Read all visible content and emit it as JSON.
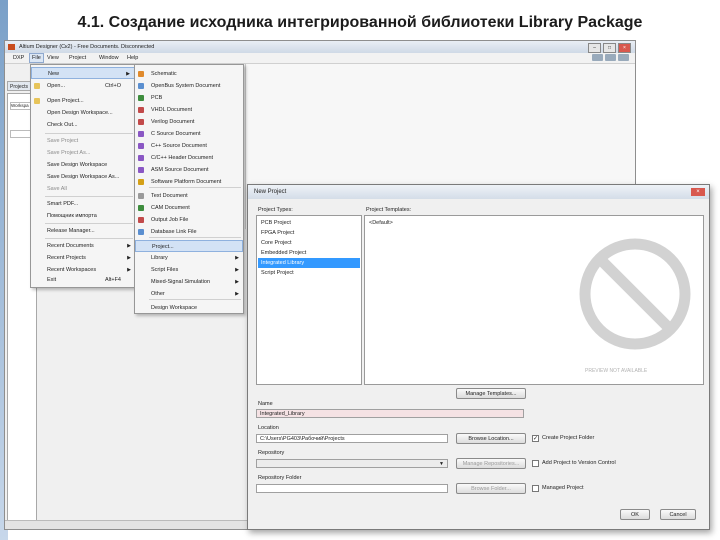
{
  "slide": {
    "title": "4.1. Создание исходника интегрированной библиотеки Library Package"
  },
  "app": {
    "title": "Altium Designer (Ск2) - Free Documents. Disconnected",
    "menu": [
      "DXP",
      "File",
      "View",
      "Project",
      "Window",
      "Help"
    ],
    "panel_tab": "Projects",
    "panel_field_1": "Workspa",
    "panel_field_2": ""
  },
  "file_menu": {
    "items": [
      {
        "label": "New",
        "shortcut": "",
        "submenu": true,
        "highlight": true
      },
      {
        "label": "Open...",
        "shortcut": "Ctrl+O"
      },
      {
        "label": "Open Project..."
      },
      {
        "label": "Open Design Workspace..."
      },
      {
        "label": "Check Out..."
      },
      {
        "label": "Save Project",
        "dim": true
      },
      {
        "label": "Save Project As...",
        "dim": true
      },
      {
        "label": "Save Design Workspace"
      },
      {
        "label": "Save Design Workspace As..."
      },
      {
        "label": "Save All",
        "dim": true
      },
      {
        "label": "Smart PDF..."
      },
      {
        "label": "Помощник импорта"
      },
      {
        "label": "Release Manager..."
      },
      {
        "label": "Recent Documents",
        "submenu": true
      },
      {
        "label": "Recent Projects",
        "submenu": true
      },
      {
        "label": "Recent Workspaces",
        "submenu": true
      },
      {
        "label": "Exit",
        "shortcut": "Alt+F4"
      }
    ]
  },
  "new_submenu": {
    "items": [
      {
        "label": "Schematic",
        "color": "#e08a2c"
      },
      {
        "label": "OpenBus System Document",
        "color": "#5b8fd0"
      },
      {
        "label": "PCB",
        "color": "#3d8d3d"
      },
      {
        "label": "VHDL Document",
        "color": "#c24a4a"
      },
      {
        "label": "Verilog Document",
        "color": "#c24a4a"
      },
      {
        "label": "C Source Document",
        "color": "#8a57c4"
      },
      {
        "label": "C++ Source Document",
        "color": "#8a57c4"
      },
      {
        "label": "C/C++ Header Document",
        "color": "#8a57c4"
      },
      {
        "label": "ASM Source Document",
        "color": "#8a57c4"
      },
      {
        "label": "Software Platform Document",
        "color": "#d4a017"
      },
      {
        "label": "Text Document",
        "color": "#9a9a9a"
      },
      {
        "label": "CAM Document",
        "color": "#3d8d3d"
      },
      {
        "label": "Output Job File",
        "color": "#c24a4a"
      },
      {
        "label": "Database Link File",
        "color": "#5b8fd0"
      },
      {
        "label": "Project...",
        "highlight": true
      },
      {
        "label": "Library",
        "submenu": true
      },
      {
        "label": "Script Files",
        "submenu": true
      },
      {
        "label": "Mixed-Signal Simulation",
        "submenu": true
      },
      {
        "label": "Other",
        "submenu": true
      },
      {
        "label": "Design Workspace"
      }
    ]
  },
  "dialog": {
    "title": "New Project",
    "project_types_label": "Project Types:",
    "project_types": [
      "PCB Project",
      "FPGA Project",
      "Core Project",
      "Embedded Project",
      "Integrated Library",
      "Script Project"
    ],
    "selected_index": 4,
    "templates_label": "Project Templates:",
    "template_item": "<Default>",
    "preview_caption": "PREVIEW NOT AVAILABLE",
    "manage_templates": "Manage Templates...",
    "name_label": "Name",
    "name_value": "Integrated_Library",
    "location_label": "Location",
    "location_value": "C:\\Users\\PG403\\Рабочий\\Projects",
    "browse_location": "Browse Location...",
    "create_folder": "Create Project Folder",
    "repository_label": "Repository",
    "manage_repositories": "Manage Repositories...",
    "add_vcs": "Add Project to Version Control",
    "working_folder_label": "Repository Folder",
    "browse_folder": "Browse Folder...",
    "managed_project": "Managed Project",
    "ok": "OK",
    "cancel": "Cancel"
  }
}
